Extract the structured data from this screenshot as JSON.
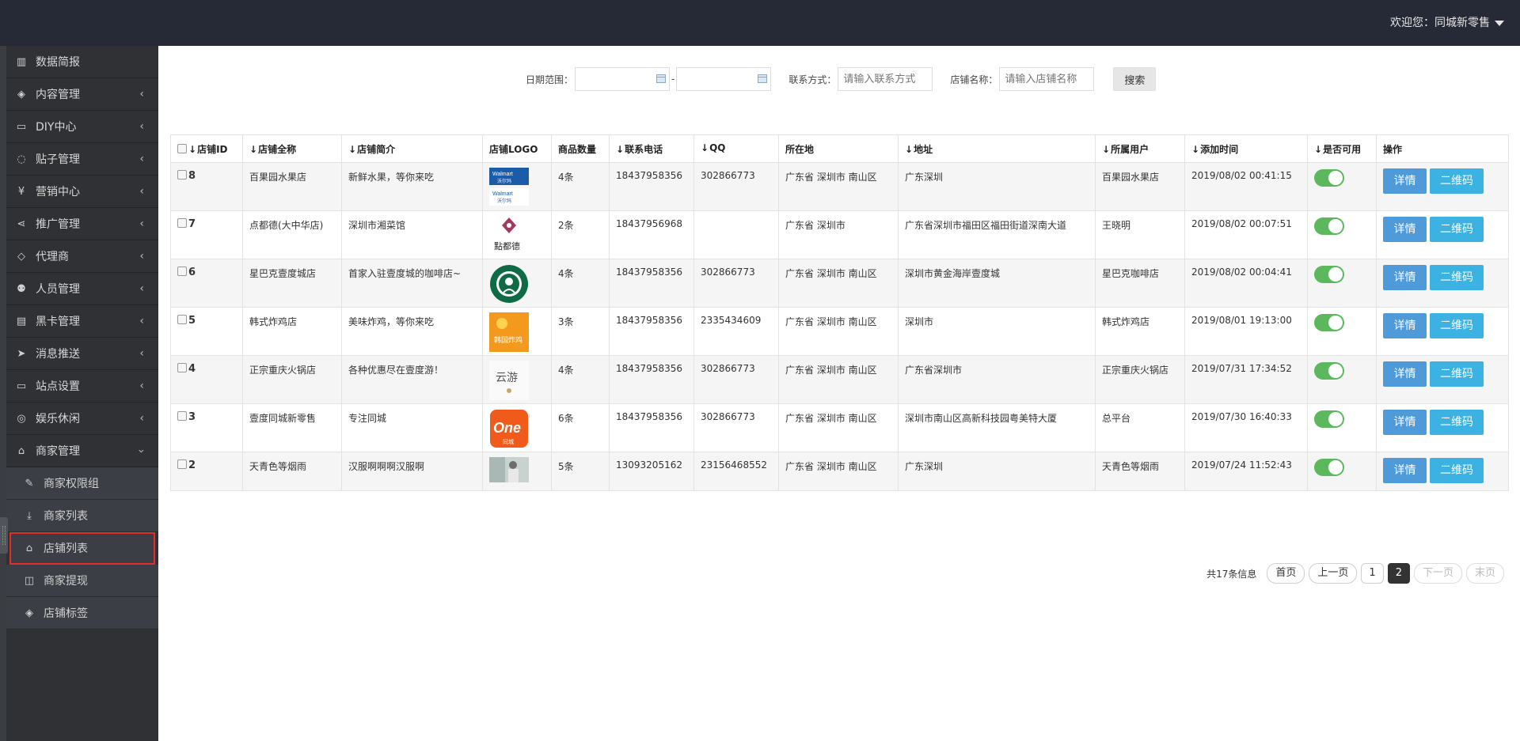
{
  "header": {
    "welcome": "欢迎您：同城新零售"
  },
  "sidebar": {
    "items": [
      {
        "label": "数据简报",
        "icon": "bar-chart-icon"
      },
      {
        "label": "内容管理",
        "icon": "tags-icon"
      },
      {
        "label": "DIY中心",
        "icon": "desktop-icon"
      },
      {
        "label": "贴子管理",
        "icon": "comment-icon"
      },
      {
        "label": "营销中心",
        "icon": "yen-icon"
      },
      {
        "label": "推广管理",
        "icon": "share-icon"
      },
      {
        "label": "代理商",
        "icon": "diamond-icon"
      },
      {
        "label": "人员管理",
        "icon": "users-icon"
      },
      {
        "label": "黑卡管理",
        "icon": "id-card-icon"
      },
      {
        "label": "消息推送",
        "icon": "paper-plane-icon"
      },
      {
        "label": "站点设置",
        "icon": "desktop-icon"
      },
      {
        "label": "娱乐休闲",
        "icon": "gamepad-icon"
      },
      {
        "label": "商家管理",
        "icon": "bank-icon"
      }
    ],
    "subitems": [
      {
        "label": "商家权限组",
        "icon": "edit-icon"
      },
      {
        "label": "商家列表",
        "icon": "download-icon"
      },
      {
        "label": "店铺列表",
        "icon": "bank-icon"
      },
      {
        "label": "商家提现",
        "icon": "money-icon"
      },
      {
        "label": "店铺标签",
        "icon": "tags-icon"
      }
    ]
  },
  "search": {
    "date_label": "日期范围：",
    "date_sep": "-",
    "contact_label": "联系方式：",
    "contact_placeholder": "请输入联系方式",
    "shop_label": "店铺名称：",
    "shop_placeholder": "请输入店铺名称",
    "button": "搜索"
  },
  "table": {
    "headers": [
      "店铺ID",
      "店铺全称",
      "店铺简介",
      "店铺LOGO",
      "商品数量",
      "联系电话",
      "QQ",
      "所在地",
      "地址",
      "所属用户",
      "添加时间",
      "是否可用",
      "操作"
    ],
    "detail_label": "详情",
    "qr_label": "二维码",
    "rows": [
      {
        "id": "8",
        "name": "百果园水果店",
        "intro": "新鲜水果，等你来吃",
        "logo": "walmart",
        "count": "4条",
        "phone": "18437958356",
        "qq": "302866773",
        "region": "广东省 深圳市 南山区",
        "address": "广东深圳",
        "user": "百果园水果店",
        "time": "2019/08/02 00:41:15",
        "enabled": true
      },
      {
        "id": "7",
        "name": "点都德(大中华店)",
        "intro": "深圳市湘菜馆",
        "logo": "diandude",
        "count": "2条",
        "phone": "18437956968",
        "qq": "",
        "region": "广东省 深圳市",
        "address": "广东省深圳市福田区福田街道深南大道",
        "user": "王晓明",
        "time": "2019/08/02 00:07:51",
        "enabled": true
      },
      {
        "id": "6",
        "name": "星巴克壹度城店",
        "intro": "首家入驻壹度城的咖啡店~",
        "logo": "starbucks",
        "count": "4条",
        "phone": "18437958356",
        "qq": "302866773",
        "region": "广东省 深圳市 南山区",
        "address": "深圳市黄金海岸壹度城",
        "user": "星巴克咖啡店",
        "time": "2019/08/02 00:04:41",
        "enabled": true
      },
      {
        "id": "5",
        "name": "韩式炸鸡店",
        "intro": "美味炸鸡，等你来吃",
        "logo": "chicken",
        "count": "3条",
        "phone": "18437958356",
        "qq": "2335434609",
        "region": "广东省 深圳市 南山区",
        "address": "深圳市",
        "user": "韩式炸鸡店",
        "time": "2019/08/01 19:13:00",
        "enabled": true
      },
      {
        "id": "4",
        "name": "正宗重庆火锅店",
        "intro": "各种优惠尽在壹度游！",
        "logo": "yunyou",
        "count": "4条",
        "phone": "18437958356",
        "qq": "302866773",
        "region": "广东省 深圳市 南山区",
        "address": "广东省深圳市",
        "user": "正宗重庆火锅店",
        "time": "2019/07/31 17:34:52",
        "enabled": true
      },
      {
        "id": "3",
        "name": "壹度同城新零售",
        "intro": "专注同城",
        "logo": "one",
        "count": "6条",
        "phone": "18437958356",
        "qq": "302866773",
        "region": "广东省 深圳市 南山区",
        "address": "深圳市南山区高新科技园粤美特大厦",
        "user": "总平台",
        "time": "2019/07/30 16:40:33",
        "enabled": true
      },
      {
        "id": "2",
        "name": "天青色等烟雨",
        "intro": "汉服啊啊啊汉服啊",
        "logo": "photo",
        "count": "5条",
        "phone": "13093205162",
        "qq": "23156468552",
        "region": "广东省 深圳市 南山区",
        "address": "广东深圳",
        "user": "天青色等烟雨",
        "time": "2019/07/24 11:52:43",
        "enabled": true
      }
    ]
  },
  "pagination": {
    "total": "共17条信息",
    "first": "首页",
    "prev": "上一页",
    "pages": [
      "1",
      "2"
    ],
    "current": "2",
    "next": "下一页",
    "last": "末页"
  },
  "logo_text": {
    "walmart": "Walmart",
    "walmart_cn": "沃尔玛",
    "diandude": "點都德",
    "chicken": "韩国炸鸡",
    "one": "One",
    "one_sub": "同城",
    "yunyou": "云游"
  },
  "colors": {
    "topbar": "#252a36",
    "sidebar": "#2f3135",
    "toggle_on": "#5cb85c",
    "btn_detail": "#4f9ad9",
    "btn_qr": "#3cb2e2",
    "active_outline": "#e22d2d"
  }
}
